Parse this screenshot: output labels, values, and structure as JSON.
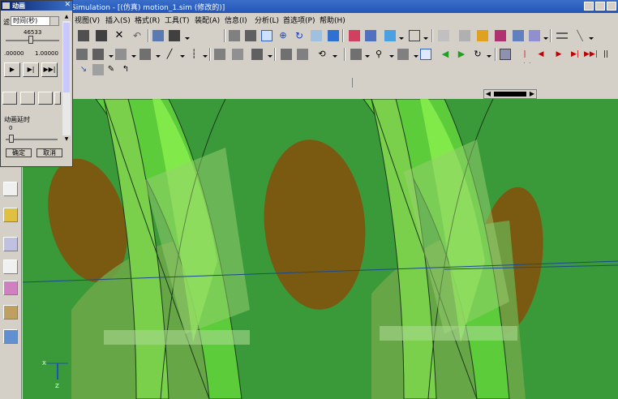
{
  "window": {
    "title": "Simulation - [(仿真) motion_1.sim (修改的)]"
  },
  "menubar": {
    "items": [
      "视图(V)",
      "插入(S)",
      "格式(R)",
      "工具(T)",
      "装配(A)",
      "信息(I)",
      "分析(L)",
      "首选项(P)",
      "帮助(H)"
    ]
  },
  "dialog": {
    "title": "动画",
    "close": "✕",
    "mode_prefix": "滤",
    "mode_value": "时间(秒)",
    "time_value": "46533",
    "range_min": ".00000",
    "range_max": "1.00000",
    "slider_fraction": 0.46533,
    "play_buttons": [
      "▶",
      "▶|",
      "▶▶|"
    ],
    "delay_label": "动画延时",
    "delay_value": "0",
    "ok_label": "确定",
    "cancel_label": "取消"
  },
  "viewport": {
    "axis_labels": {
      "x": "X",
      "z": "Z"
    }
  },
  "colors": {
    "viewport_bg": "#3a9a3a",
    "title_bar": "#2356b8",
    "ellipse_fill": "#7a5a10",
    "part_fill": "#5ccc3a",
    "highlight": "#8cf050"
  },
  "icons": {
    "toolbar1": [
      "fit-icon",
      "zoom-icon",
      "rotate-icon",
      "pan-icon",
      "shaded-icon",
      "wireframe-icon",
      "view-icon",
      "layer-icon",
      "snap-icon",
      "selection-icon",
      "measure-icon"
    ],
    "playback": [
      "step-back-icon",
      "play-back-icon",
      "stop-icon",
      "play-icon",
      "step-forward-icon",
      "pause-icon"
    ]
  }
}
